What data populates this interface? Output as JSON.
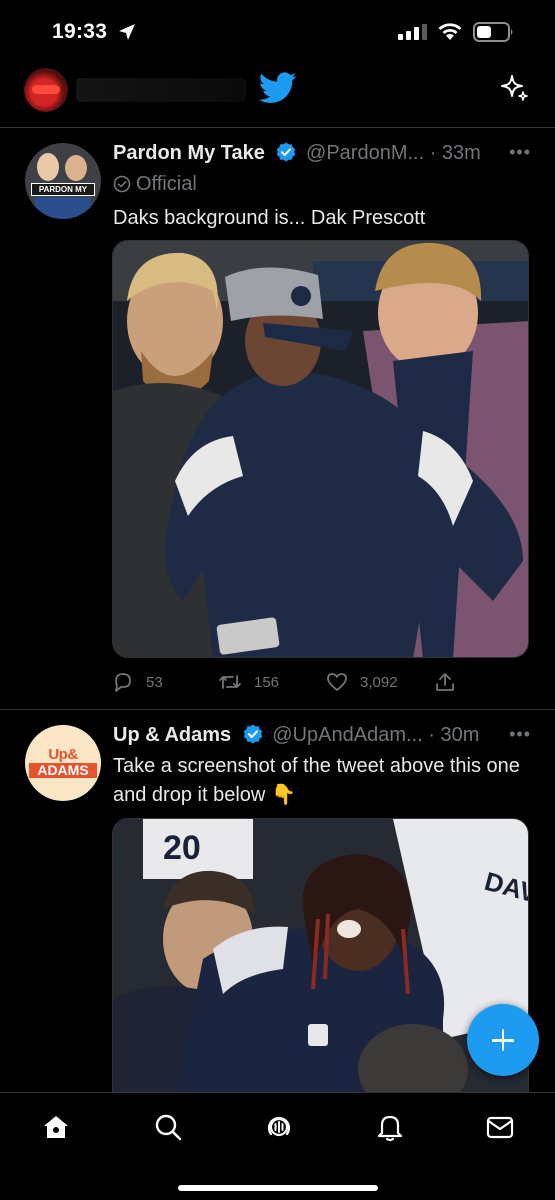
{
  "status_bar": {
    "time": "19:33"
  },
  "topbar": {
    "logo_icon": "twitter-bird-icon",
    "right_icon": "sparkle-icon",
    "brand_color": "#1d9bf0"
  },
  "tweets": [
    {
      "name": "Pardon My Take",
      "handle": "@PardonM...",
      "time": "· 33m",
      "official_label": "Official",
      "text": "Daks background is... Dak Prescott",
      "avatar_text": "PARDON MY TAKE",
      "replies": "53",
      "retweets": "156",
      "likes": "3,092"
    },
    {
      "name": "Up & Adams",
      "handle": "@UpAndAdam...",
      "time": "· 30m",
      "text": "Take a screenshot of the tweet above this one and drop it below",
      "emoji": "👇",
      "avatar_text_1": "Up&",
      "avatar_text_2": "ADAMS"
    }
  ],
  "tabbar": {
    "tabs": [
      "home-icon",
      "search-icon",
      "spaces-icon",
      "notifications-icon",
      "messages-icon"
    ]
  }
}
